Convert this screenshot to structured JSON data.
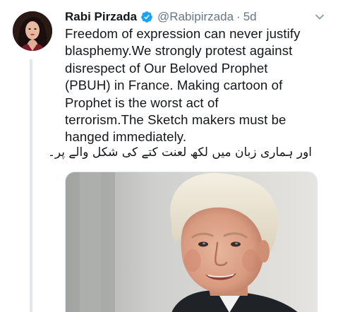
{
  "tweet": {
    "display_name": "Rabi Pirzada",
    "handle": "@Rabipirzada",
    "separator": "·",
    "time": "5d",
    "text_lines": [
      "Freedom of expression can never justify",
      "blasphemy.We strongly protest against",
      "disrespect of Our Beloved Prophet",
      "(PBUH) in France. Making cartoon of",
      "Prophet is the worst act of",
      "terrorism.The Sketch makers must be",
      "hanged immediately."
    ],
    "urdu_line": "اور ہماری زبان میں لکھ لعنت کتے کی شکل والے پر۔"
  },
  "colors": {
    "name": "#14171a",
    "secondary": "#657786",
    "verified": "#1da1f2",
    "thread_line": "#e1e8ed"
  },
  "icons": {
    "verified": "verified-badge-icon",
    "menu": "chevron-down-icon"
  }
}
